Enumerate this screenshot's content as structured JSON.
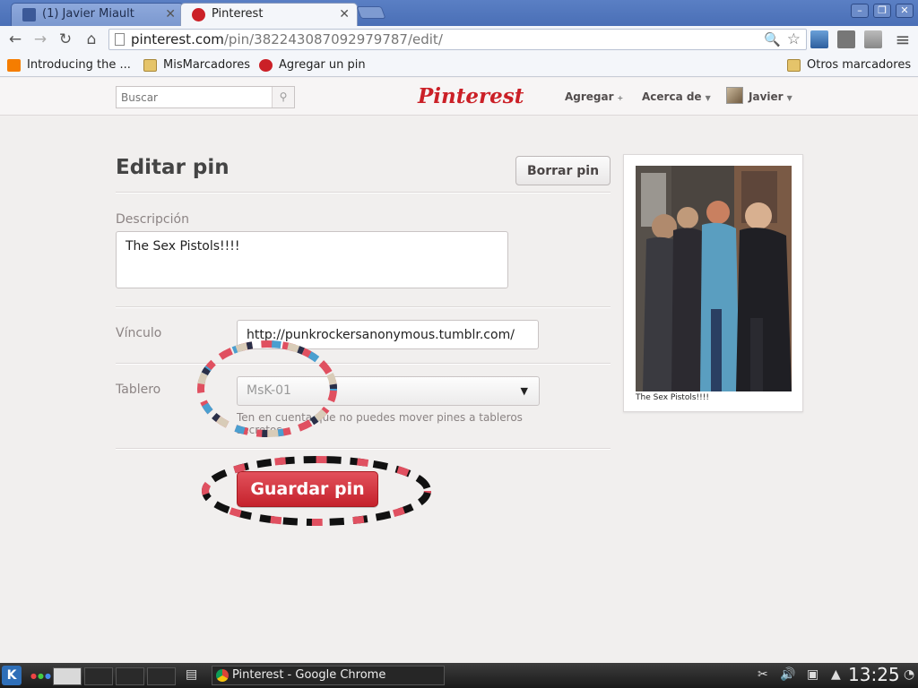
{
  "browser": {
    "tabs": [
      {
        "title": "(1) Javier Miault",
        "active": false
      },
      {
        "title": "Pinterest",
        "active": true
      }
    ],
    "url_host": "pinterest.com",
    "url_path": "/pin/382243087092979787/edit/",
    "bookmarks": [
      {
        "label": "Introducing the ...",
        "icon": "blogger-icon"
      },
      {
        "label": "MisMarcadores",
        "icon": "folder-icon"
      },
      {
        "label": "Agregar un pin",
        "icon": "pinterest-icon"
      }
    ],
    "other_bookmarks": "Otros marcadores"
  },
  "header": {
    "search_placeholder": "Buscar",
    "logo": "Pinterest",
    "nav": {
      "add": "Agregar",
      "about": "Acerca de",
      "user": "Javier"
    }
  },
  "form": {
    "title": "Editar pin",
    "delete_button": "Borrar pin",
    "description_label": "Descripción",
    "description_value": "The Sex Pistols!!!!",
    "link_label": "Vínculo",
    "link_value": "http://punkrockersanonymous.tumblr.com/",
    "board_label": "Tablero",
    "board_value": "MsK-01",
    "board_hint": "Ten en cuenta que no puedes mover pines a tableros secretos.",
    "save_button": "Guardar pin"
  },
  "pin_preview": {
    "caption": "The Sex Pistols!!!!"
  },
  "taskbar": {
    "task_title": "Pinterest - Google Chrome",
    "clock": "13:25"
  },
  "colors": {
    "brand_red": "#cb2027",
    "save_button": "#d23a43",
    "tabstrip": "#5a7fc4"
  }
}
